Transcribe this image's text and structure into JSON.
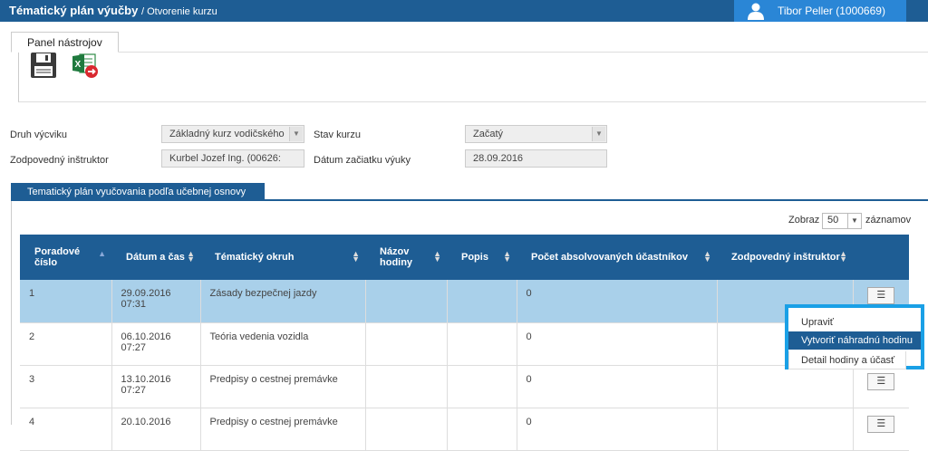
{
  "header": {
    "title": "Tématický plán výučby",
    "subtitle": "/ Otvorenie kurzu",
    "user": "Tibor Peller (1000669)"
  },
  "toolbar": {
    "panel_label": "Panel nástrojov",
    "buttons": [
      "save-icon",
      "excel-export-icon"
    ]
  },
  "form": {
    "druh_label": "Druh výcviku",
    "druh_value": "Základný kurz vodičského",
    "stav_label": "Stav kurzu",
    "stav_value": "Začatý",
    "instruktor_label": "Zodpovedný inštruktor",
    "instruktor_value": "Kurbel Jozef Ing. (00626:",
    "datum_label": "Dátum začiatku výuky",
    "datum_value": "28.09.2016"
  },
  "section": {
    "title": "Tematický plán vyučovania podľa učebnej osnovy"
  },
  "paging": {
    "show_label": "Zobraz",
    "page_size": "50",
    "records_label": "záznamov"
  },
  "table": {
    "columns": [
      "Poradové číslo",
      "Dátum a čas",
      "Tématický okruh",
      "Názov hodiny",
      "Popis",
      "Počet absolvovaných účastníkov",
      "Zodpovedný inštruktor",
      ""
    ],
    "rows": [
      {
        "cislo": "1",
        "datum": "29.09.2016",
        "cas": "07:31",
        "okruh": "Zásady bezpečnej jazdy",
        "nazov": "",
        "popis": "",
        "pocet": "0",
        "instruktor": ""
      },
      {
        "cislo": "2",
        "datum": "06.10.2016",
        "cas": "07:27",
        "okruh": "Teória vedenia vozidla",
        "nazov": "",
        "popis": "",
        "pocet": "0",
        "instruktor": ""
      },
      {
        "cislo": "3",
        "datum": "13.10.2016",
        "cas": "07:27",
        "okruh": "Predpisy o cestnej premávke",
        "nazov": "",
        "popis": "",
        "pocet": "0",
        "instruktor": ""
      },
      {
        "cislo": "4",
        "datum": "20.10.2016",
        "cas": "",
        "okruh": "Predpisy o cestnej premávke",
        "nazov": "",
        "popis": "",
        "pocet": "0",
        "instruktor": ""
      }
    ]
  },
  "context_menu": {
    "items": [
      "Upraviť",
      "Vytvoriť náhradnú hodinu",
      "Detail hodiny a účasť"
    ]
  },
  "colors": {
    "primary": "#1e5d94",
    "user_box": "#2a86d6",
    "selected_row": "#a9d0ea",
    "highlight": "#1aa0e6"
  }
}
